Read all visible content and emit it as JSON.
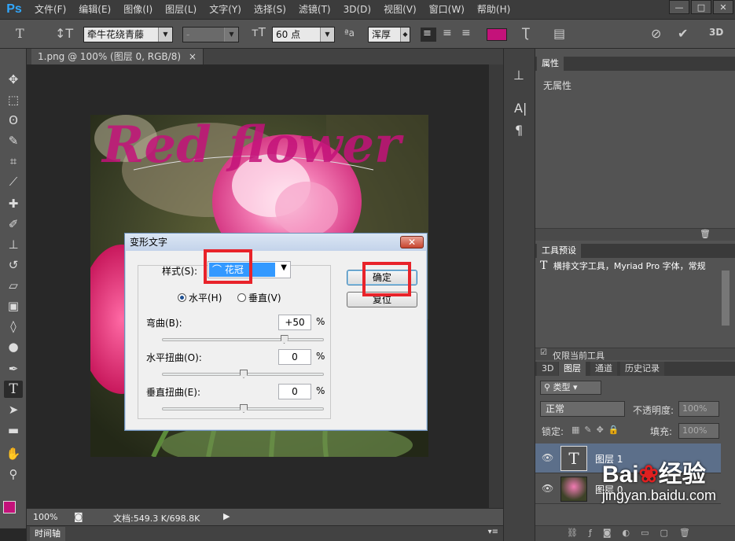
{
  "app": {
    "logo": "Ps"
  },
  "menu": [
    "文件(F)",
    "编辑(E)",
    "图像(I)",
    "图层(L)",
    "文字(Y)",
    "选择(S)",
    "滤镜(T)",
    "3D(D)",
    "视图(V)",
    "窗口(W)",
    "帮助(H)"
  ],
  "window_controls": [
    "—",
    "□",
    "✕"
  ],
  "options": {
    "font_family": "牵牛花绕青藤",
    "font_style": "-",
    "font_size": "60 点",
    "aa_label": "ªa",
    "antialias": "浑厚",
    "text_color": "#c4127a",
    "threed_label": "3D"
  },
  "document": {
    "tab_title": "1.png @ 100% (图层 0, RGB/8)",
    "tab_close": "×",
    "art_text": "Red flower",
    "art_color": "#c4127a",
    "zoom": "100%",
    "doc_info": "文档:549.3 K/698.8K",
    "timeline_label": "时间轴"
  },
  "dialog": {
    "title": "变形文字",
    "close_label": "✕",
    "style_label": "样式(S):",
    "style_value": "花冠",
    "horizontal_label": "水平(H)",
    "vertical_label": "垂直(V)",
    "bend_label": "弯曲(B):",
    "bend_value": "+50",
    "bend_fraction": 0.75,
    "hdistort_label": "水平扭曲(O):",
    "hdistort_value": "0",
    "hdistort_fraction": 0.5,
    "vdistort_label": "垂直扭曲(E):",
    "vdistort_value": "0",
    "vdistort_fraction": 0.5,
    "percent": "%",
    "ok_label": "确定",
    "reset_label": "复位"
  },
  "properties": {
    "tab": "属性",
    "content": "无属性"
  },
  "tool_presets": {
    "tab": "工具预设",
    "item": "横排文字工具，Myriad Pro 字体，常规",
    "only_current": "仅限当前工具"
  },
  "layers": {
    "tabs": [
      "3D",
      "图层",
      "通道",
      "历史记录"
    ],
    "filter": "类型",
    "blend_mode": "正常",
    "opacity_label": "不透明度:",
    "opacity_value": "100%",
    "lock_label": "锁定:",
    "fill_label": "填充:",
    "fill_value": "100%",
    "items": [
      {
        "name": "图层 1",
        "kind": "text"
      },
      {
        "name": "图层 0",
        "kind": "image"
      }
    ]
  },
  "watermark": {
    "brand": "Bai",
    "brand2": "经验",
    "url": "jingyan.baidu.com"
  }
}
